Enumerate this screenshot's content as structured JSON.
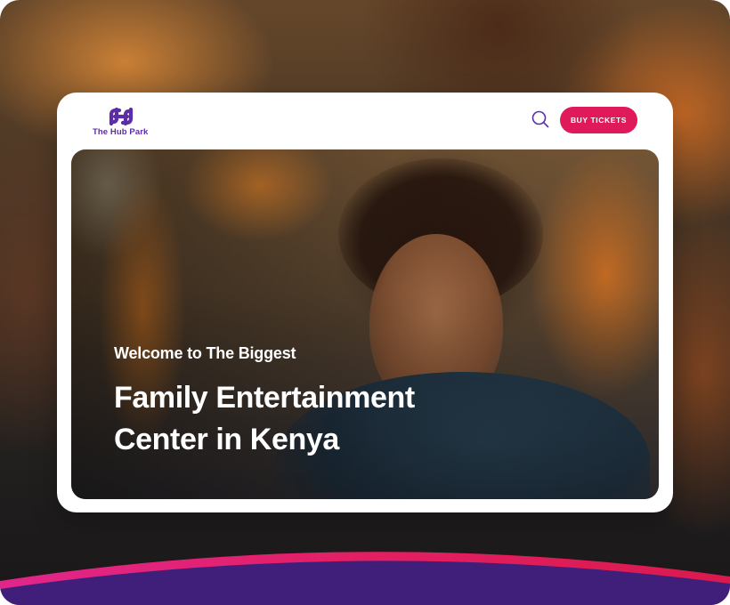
{
  "brand": {
    "name": "The Hub Park",
    "logo_icon": "hub-park-logo-icon",
    "color": "#5b2ea6"
  },
  "header": {
    "search_icon": "search-icon",
    "buy_tickets_label": "BUY TICKETS",
    "accent_color": "#e0195a"
  },
  "hero": {
    "subtitle": "Welcome to The Biggest",
    "title_line_1": "Family Entertainment",
    "title_line_2": "Center in Kenya"
  },
  "footer_wave": {
    "colors": [
      "#e0195a",
      "#3f1f7a"
    ]
  }
}
